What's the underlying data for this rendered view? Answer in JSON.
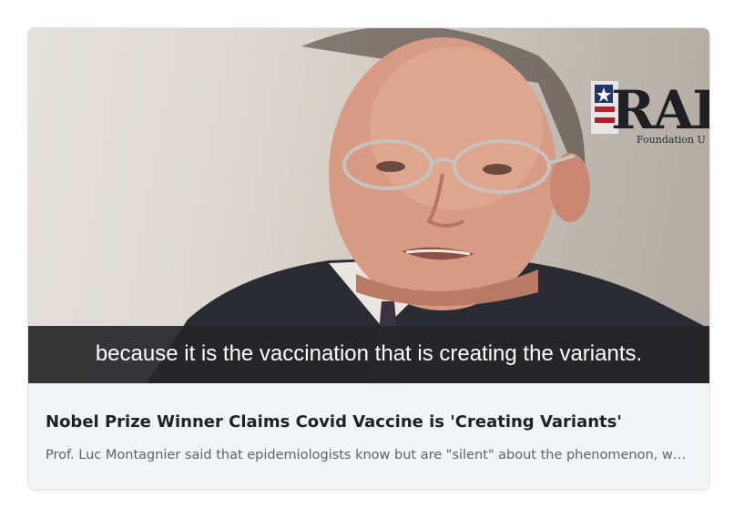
{
  "card": {
    "image": {
      "alt_subject": "video-still-of-speaker",
      "subtitle": "because it is the vaccination that is creating the variants.",
      "logo_text": "RAIF",
      "logo_subtext": "Foundation U"
    },
    "title": "Nobel Prize Winner Claims Covid Vaccine is 'Creating Variants'",
    "snippet": "Prof. Luc Montagnier said that epidemiologists know but are \"silent\" about the phenomenon, which he called an \"unacceptable mistake.\""
  },
  "colors": {
    "card_background": "#f1f3f4",
    "title_text": "#202124",
    "snippet_text": "#5f6368",
    "subtitle_band": "#262628"
  }
}
